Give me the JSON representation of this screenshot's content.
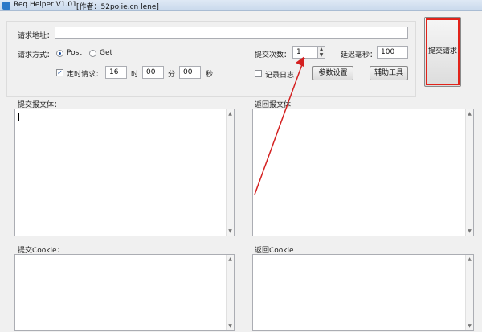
{
  "window": {
    "title": "Req Helper V1.01",
    "author": "[作者：52pojie.cn lene]"
  },
  "form": {
    "url_label": "请求地址：",
    "url_value": "",
    "method_label": "请求方式：",
    "methods": [
      "Post",
      "Get"
    ],
    "method_selected": "Post",
    "timer_label": "定时请求：",
    "timer_checked": true,
    "timer_hour": "16",
    "hour_unit": "时",
    "timer_minute": "00",
    "minute_unit": "分",
    "timer_second": "00",
    "second_unit": "秒",
    "count_label": "提交次数：",
    "count_value": "1",
    "delay_label": "延迟毫秒：",
    "delay_value": "100",
    "log_label": "记录日志",
    "log_checked": false
  },
  "buttons": {
    "params": "参数设置",
    "tools": "辅助工具",
    "submit": "提交请求"
  },
  "panels": {
    "submit_body_label": "提交报文体：",
    "return_body_label": "返回报文体",
    "submit_cookie_label": "提交Cookie：",
    "return_cookie_label": "返回Cookie"
  },
  "colors": {
    "highlight": "#e2231a",
    "arrow": "#d42020"
  }
}
